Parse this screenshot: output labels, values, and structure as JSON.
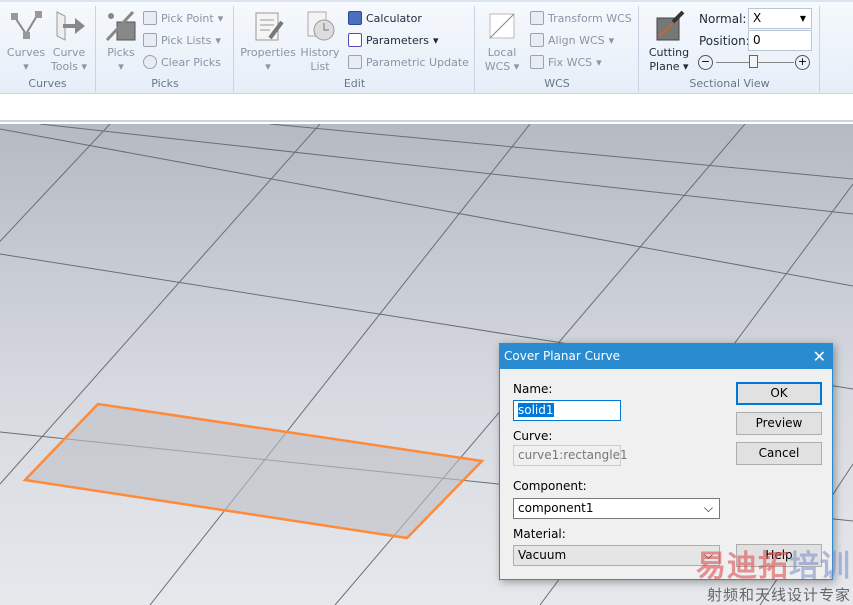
{
  "ribbon": {
    "curves": {
      "label": "Curves",
      "curves_btn": "Curves",
      "curve_tools": "Curve\nTools",
      "curve_tools_1": "Curve",
      "curve_tools_2": "Tools"
    },
    "picks": {
      "label": "Picks",
      "picks_btn": "Picks",
      "pick_point": "Pick Point",
      "pick_lists": "Pick Lists",
      "clear_picks": "Clear Picks"
    },
    "edit": {
      "label": "Edit",
      "properties": "Properties",
      "history_1": "History",
      "history_2": "List",
      "calculator": "Calculator",
      "parameters": "Parameters",
      "parametric_update": "Parametric Update"
    },
    "wcs": {
      "label": "WCS",
      "local_1": "Local",
      "local_2": "WCS",
      "transform": "Transform WCS",
      "align": "Align WCS",
      "fix": "Fix WCS"
    },
    "sectional": {
      "label": "Sectional View",
      "cutting_1": "Cutting",
      "cutting_2": "Plane",
      "normal_label": "Normal:",
      "normal_value": "X",
      "position_label": "Position:",
      "position_value": "0",
      "slider_value": 0.5
    }
  },
  "dialog": {
    "title": "Cover Planar Curve",
    "name_label": "Name:",
    "name_value": "solid1",
    "curve_label": "Curve:",
    "curve_value": "curve1:rectangle1",
    "component_label": "Component:",
    "component_value": "component1",
    "material_label": "Material:",
    "material_value": "Vacuum",
    "ok": "OK",
    "preview": "Preview",
    "cancel": "Cancel",
    "help": "Help"
  },
  "watermark": {
    "line1a": "易迪拓",
    "line1b": "培训",
    "line2": "射频和天线设计专家"
  },
  "colors": {
    "accent": "#2b8bd0",
    "selection": "#ff8a3c"
  }
}
